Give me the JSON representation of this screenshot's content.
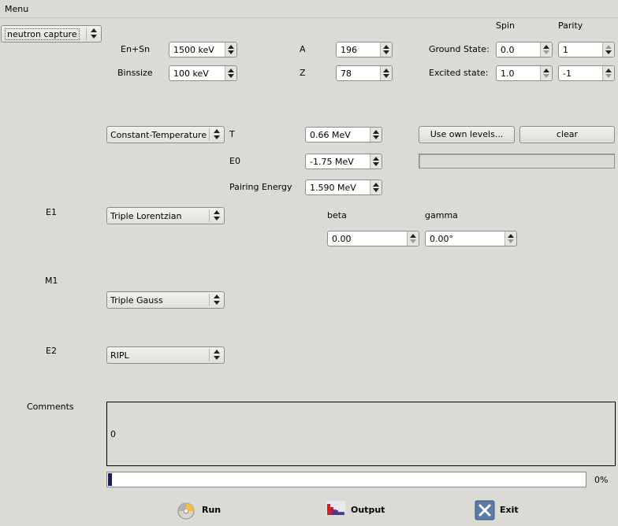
{
  "menubar": {
    "menu_label": "Menu"
  },
  "reaction": {
    "selected": "neutron capture"
  },
  "top": {
    "en_sn_label": "En+Sn",
    "en_sn_value": "1500 keV",
    "binsize_label": "Binssize",
    "binsize_value": "100 keV",
    "a_label": "A",
    "a_value": "196",
    "z_label": "Z",
    "z_value": "78",
    "spin_header": "Spin",
    "parity_header": "Parity",
    "ground_label": "Ground State:",
    "ground_spin": "0.0",
    "ground_parity": "1",
    "excited_label": "Excited state:",
    "excited_spin": "1.0",
    "excited_parity": "-1"
  },
  "level_density": {
    "model": "Constant-Temperature",
    "t_label": "T",
    "t_value": "0.66 MeV",
    "e0_label": "E0",
    "e0_value": "-1.75 MeV",
    "pairing_label": "Pairing Energy",
    "pairing_value": "1.590 MeV",
    "use_own_levels_label": "Use own levels...",
    "clear_label": "clear",
    "levels_file": ""
  },
  "e1": {
    "label": "E1",
    "model": "Triple Lorentzian",
    "beta_label": "beta",
    "beta_value": "0.00",
    "gamma_label": "gamma",
    "gamma_value": "0.00°"
  },
  "m1": {
    "label": "M1",
    "model": "Triple Gauss"
  },
  "e2": {
    "label": "E2",
    "model": "RIPL"
  },
  "comments": {
    "label": "Comments",
    "text": "0"
  },
  "progress": {
    "value": 0,
    "text": "0%"
  },
  "actions": {
    "run_label": "Run",
    "output_label": "Output",
    "exit_label": "Exit"
  }
}
